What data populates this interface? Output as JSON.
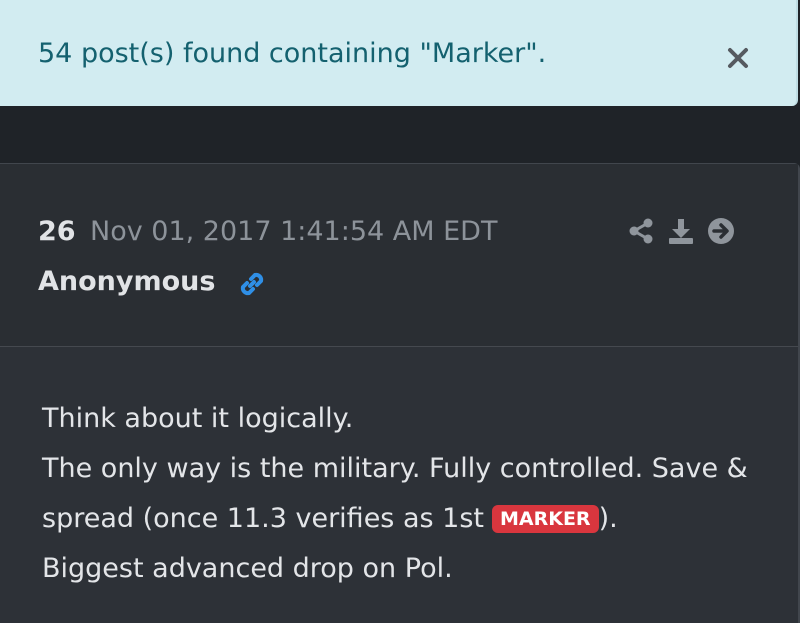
{
  "alert": {
    "message": "54 post(s) found containing \"Marker\".",
    "close_icon": "close-icon"
  },
  "post": {
    "number": "26",
    "date": "Nov 01, 2017 1:41:54 AM EDT",
    "author": "Anonymous",
    "icons": [
      "share-icon",
      "download-icon",
      "arrow-right-circle-icon",
      "link-icon"
    ],
    "body": {
      "line1": "Think about it logically.",
      "line2": "The only way is the military. Fully controlled. Save &",
      "line3_before": "spread (once 11.3 verifies as 1st",
      "line3_badge": "MARKER",
      "line3_after": ").",
      "line4": "Biggest advanced drop on Pol."
    }
  },
  "colors": {
    "alert_bg": "#d2ecf1",
    "alert_text": "#14616f",
    "card_bg": "#2d3137",
    "badge_red": "#d9363e",
    "link_blue": "#2f8fe6",
    "icon_gray": "#8f959c"
  }
}
